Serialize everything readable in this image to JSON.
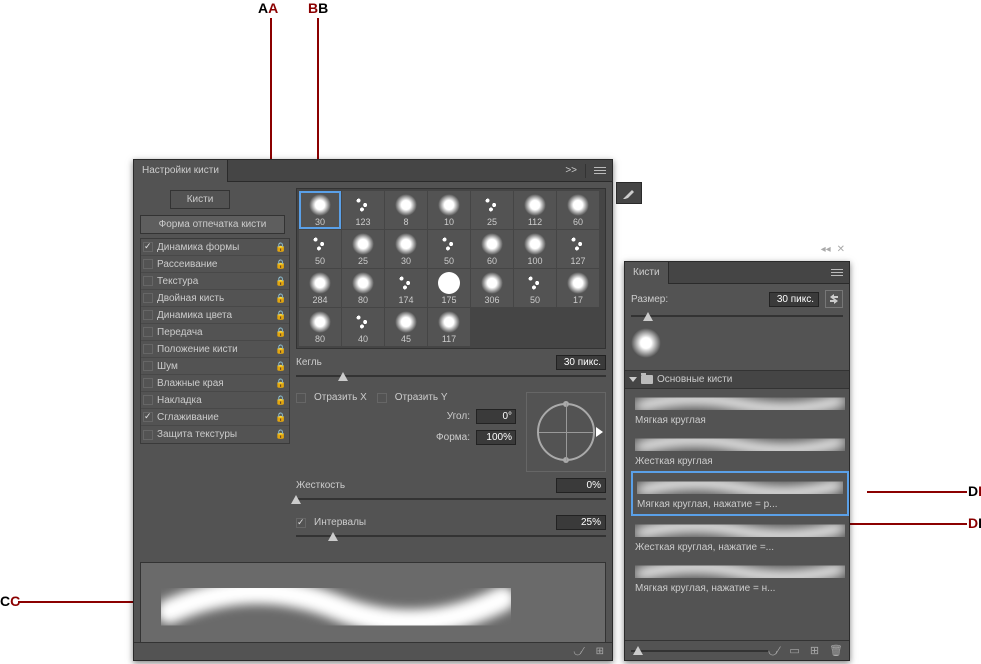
{
  "annotations": {
    "A": "A",
    "B": "B",
    "C": "C",
    "D": "D"
  },
  "left_panel": {
    "title": "Настройки кисти",
    "collapse": ">>",
    "brushes_btn": "Кисти",
    "shape_btn": "Форма отпечатка кисти",
    "options": [
      {
        "label": "Динамика формы",
        "checked": true
      },
      {
        "label": "Рассеивание",
        "checked": false
      },
      {
        "label": "Текстура",
        "checked": false
      },
      {
        "label": "Двойная кисть",
        "checked": false
      },
      {
        "label": "Динамика цвета",
        "checked": false
      },
      {
        "label": "Передача",
        "checked": false
      },
      {
        "label": "Положение кисти",
        "checked": false
      },
      {
        "label": "Шум",
        "checked": false
      },
      {
        "label": "Влажные края",
        "checked": false
      },
      {
        "label": "Накладка",
        "checked": false
      },
      {
        "label": "Сглаживание",
        "checked": true
      },
      {
        "label": "Защита текстуры",
        "checked": false
      }
    ],
    "thumbs": [
      [
        30,
        123,
        8,
        10,
        25,
        112,
        60
      ],
      [
        50,
        25,
        30,
        50,
        60,
        100,
        127
      ],
      [
        284,
        80,
        174,
        175,
        306,
        50,
        17
      ],
      [
        80,
        40,
        45,
        117,
        "",
        "",
        ""
      ]
    ],
    "size_label": "Кегль",
    "size_value": "30 пикс.",
    "flip_x": "Отразить X",
    "flip_y": "Отразить Y",
    "angle_label": "Угол:",
    "angle_value": "0°",
    "round_label": "Форма:",
    "round_value": "100%",
    "hard_label": "Жесткость",
    "hard_value": "0%",
    "spacing_label": "Интервалы",
    "spacing_value": "25%"
  },
  "right_panel": {
    "title": "Кисти",
    "size_label": "Размер:",
    "size_value": "30 пикс.",
    "group_name": "Основные кисти",
    "presets": [
      {
        "name": "Мягкая круглая",
        "selected": false
      },
      {
        "name": "Жесткая круглая",
        "selected": false
      },
      {
        "name": "Мягкая круглая, нажатие = р...",
        "selected": true
      },
      {
        "name": "Жесткая круглая, нажатие =...",
        "selected": false
      },
      {
        "name": "Мягкая круглая, нажатие = н...",
        "selected": false
      }
    ]
  }
}
